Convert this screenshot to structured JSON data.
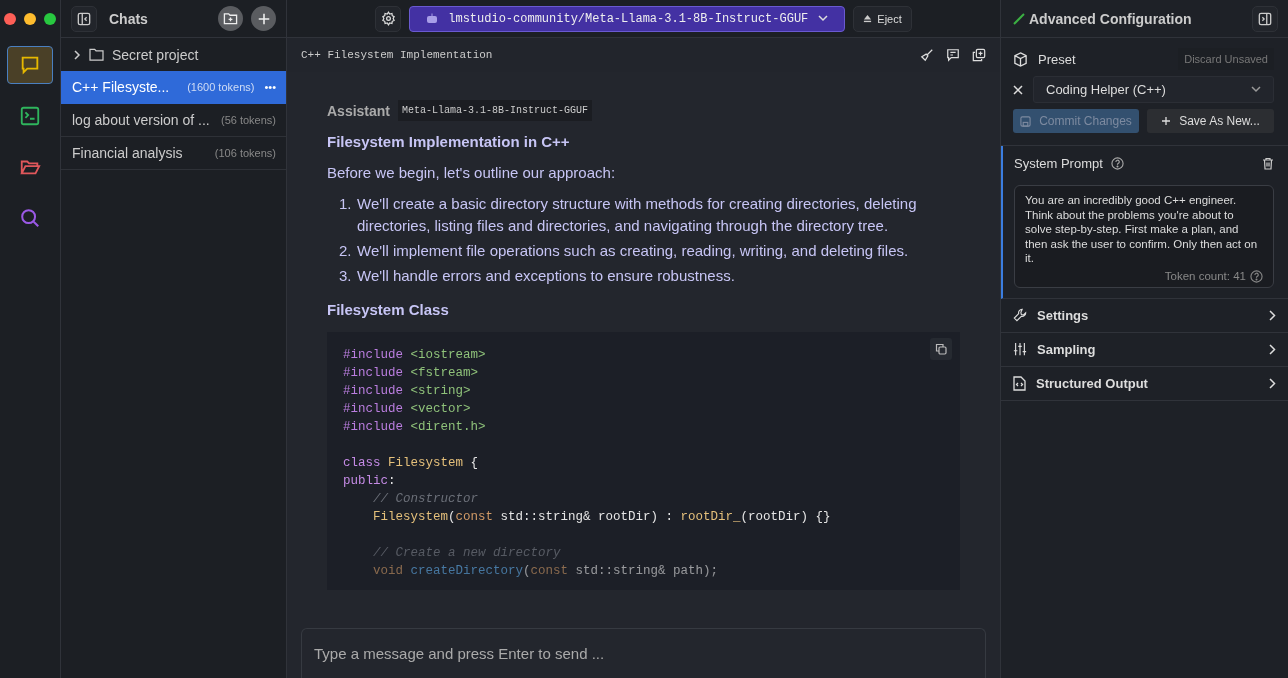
{
  "rail": [
    {
      "selected": true
    },
    {
      "selected": false
    },
    {
      "selected": false
    },
    {
      "selected": false
    }
  ],
  "sidebar": {
    "title": "Chats",
    "items": [
      {
        "kind": "folder",
        "label": "Secret project"
      },
      {
        "kind": "chat",
        "label": "C++ Filesyste...",
        "tokens": "(1600 tokens)",
        "more": "•••",
        "selected": true
      },
      {
        "kind": "chat",
        "label": "log about version of ...",
        "tokens": "(56 tokens)",
        "selected": false
      },
      {
        "kind": "chat",
        "label": "Financial analysis",
        "tokens": "(106 tokens)",
        "selected": false
      }
    ]
  },
  "topbar": {
    "model": "lmstudio-community/Meta-Llama-3.1-8B-Instruct-GGUF",
    "eject": "Eject"
  },
  "chat": {
    "title": "C++ Filesystem Implementation",
    "role": "Assistant",
    "model_tag": "Meta-Llama-3.1-8B-Instruct-GGUF",
    "blocks": [
      {
        "kind": "heading",
        "text": "Filesystem Implementation in C++"
      },
      {
        "kind": "paragraph",
        "text": "Before we begin, let's outline our approach:"
      },
      {
        "kind": "list",
        "items": [
          {
            "number": "1.",
            "text": "We'll create a basic directory structure with methods for creating directories, deleting directories, listing files and directories, and navigating through the directory tree."
          },
          {
            "number": "2.",
            "text": "We'll implement file operations such as creating, reading, writing, and deleting files."
          },
          {
            "number": "3.",
            "text": "We'll handle errors and exceptions to ensure robustness."
          }
        ]
      },
      {
        "kind": "heading",
        "text": "Filesystem Class"
      },
      {
        "kind": "code",
        "lines": [
          {
            "indented": false,
            "space_before": false,
            "tokens": [
              {
                "kind": "directive",
                "text": "#include "
              },
              {
                "kind": "string",
                "text": "<iostream>"
              }
            ]
          },
          {
            "indented": false,
            "space_before": false,
            "tokens": [
              {
                "kind": "directive",
                "text": "#include "
              },
              {
                "kind": "string",
                "text": "<fstream>"
              }
            ]
          },
          {
            "indented": false,
            "space_before": false,
            "tokens": [
              {
                "kind": "directive",
                "text": "#include "
              },
              {
                "kind": "string",
                "text": "<string>"
              }
            ]
          },
          {
            "indented": false,
            "space_before": false,
            "tokens": [
              {
                "kind": "directive",
                "text": "#include "
              },
              {
                "kind": "string",
                "text": "<vector>"
              }
            ]
          },
          {
            "indented": false,
            "space_before": false,
            "tokens": [
              {
                "kind": "directive",
                "text": "#include "
              },
              {
                "kind": "string",
                "text": "<dirent.h>"
              }
            ]
          },
          {
            "indented": false,
            "space_before": true,
            "tokens": [
              {
                "kind": "keyword",
                "text": "class "
              },
              {
                "kind": "type",
                "text": "Filesystem"
              },
              {
                "kind": "plain",
                "text": " {"
              }
            ]
          },
          {
            "indented": false,
            "space_before": false,
            "tokens": [
              {
                "kind": "keyword",
                "text": "public"
              },
              {
                "kind": "plain",
                "text": ":"
              }
            ]
          },
          {
            "indented": true,
            "space_before": false,
            "tokens": [
              {
                "kind": "comment",
                "text": "// Constructor"
              }
            ]
          },
          {
            "indented": true,
            "space_before": false,
            "tokens": [
              {
                "kind": "type",
                "text": "Filesystem"
              },
              {
                "kind": "plain",
                "text": "("
              },
              {
                "kind": "qualifier",
                "text": "const"
              },
              {
                "kind": "plain",
                "text": " std::string& rootDir) : "
              },
              {
                "kind": "type",
                "text": "rootDir_"
              },
              {
                "kind": "plain",
                "text": "(rootDir) {}"
              }
            ]
          },
          {
            "indented": true,
            "space_before": true,
            "tokens": [
              {
                "kind": "comment",
                "text": "// Create a new directory"
              }
            ]
          },
          {
            "indented": true,
            "space_before": false,
            "tokens": [
              {
                "kind": "qualifier",
                "text": "void "
              },
              {
                "kind": "function",
                "text": "createDirectory"
              },
              {
                "kind": "plain",
                "text": "("
              },
              {
                "kind": "qualifier",
                "text": "const"
              },
              {
                "kind": "plain",
                "text": " std::string& path);"
              }
            ]
          }
        ]
      }
    ]
  },
  "input": {
    "placeholder": "Type a message and press Enter to send ..."
  },
  "config": {
    "title": "Advanced Configuration",
    "preset_label": "Preset",
    "discard": "Discard Unsaved",
    "preset": "Coding Helper (C++)",
    "commit": "Commit Changes",
    "commit_disabled": true,
    "save_new": "Save As New...",
    "system_prompt": {
      "label": "System Prompt",
      "text": "You are an incredibly good C++ engineer. Think about the problems you're about to solve step-by-step. First make a plan, and then ask the user to confirm. Only then act on it.",
      "token_count": "Token count: 41"
    },
    "sections": [
      {
        "label": "Settings"
      },
      {
        "label": "Sampling"
      },
      {
        "label": "Structured Output"
      }
    ]
  }
}
